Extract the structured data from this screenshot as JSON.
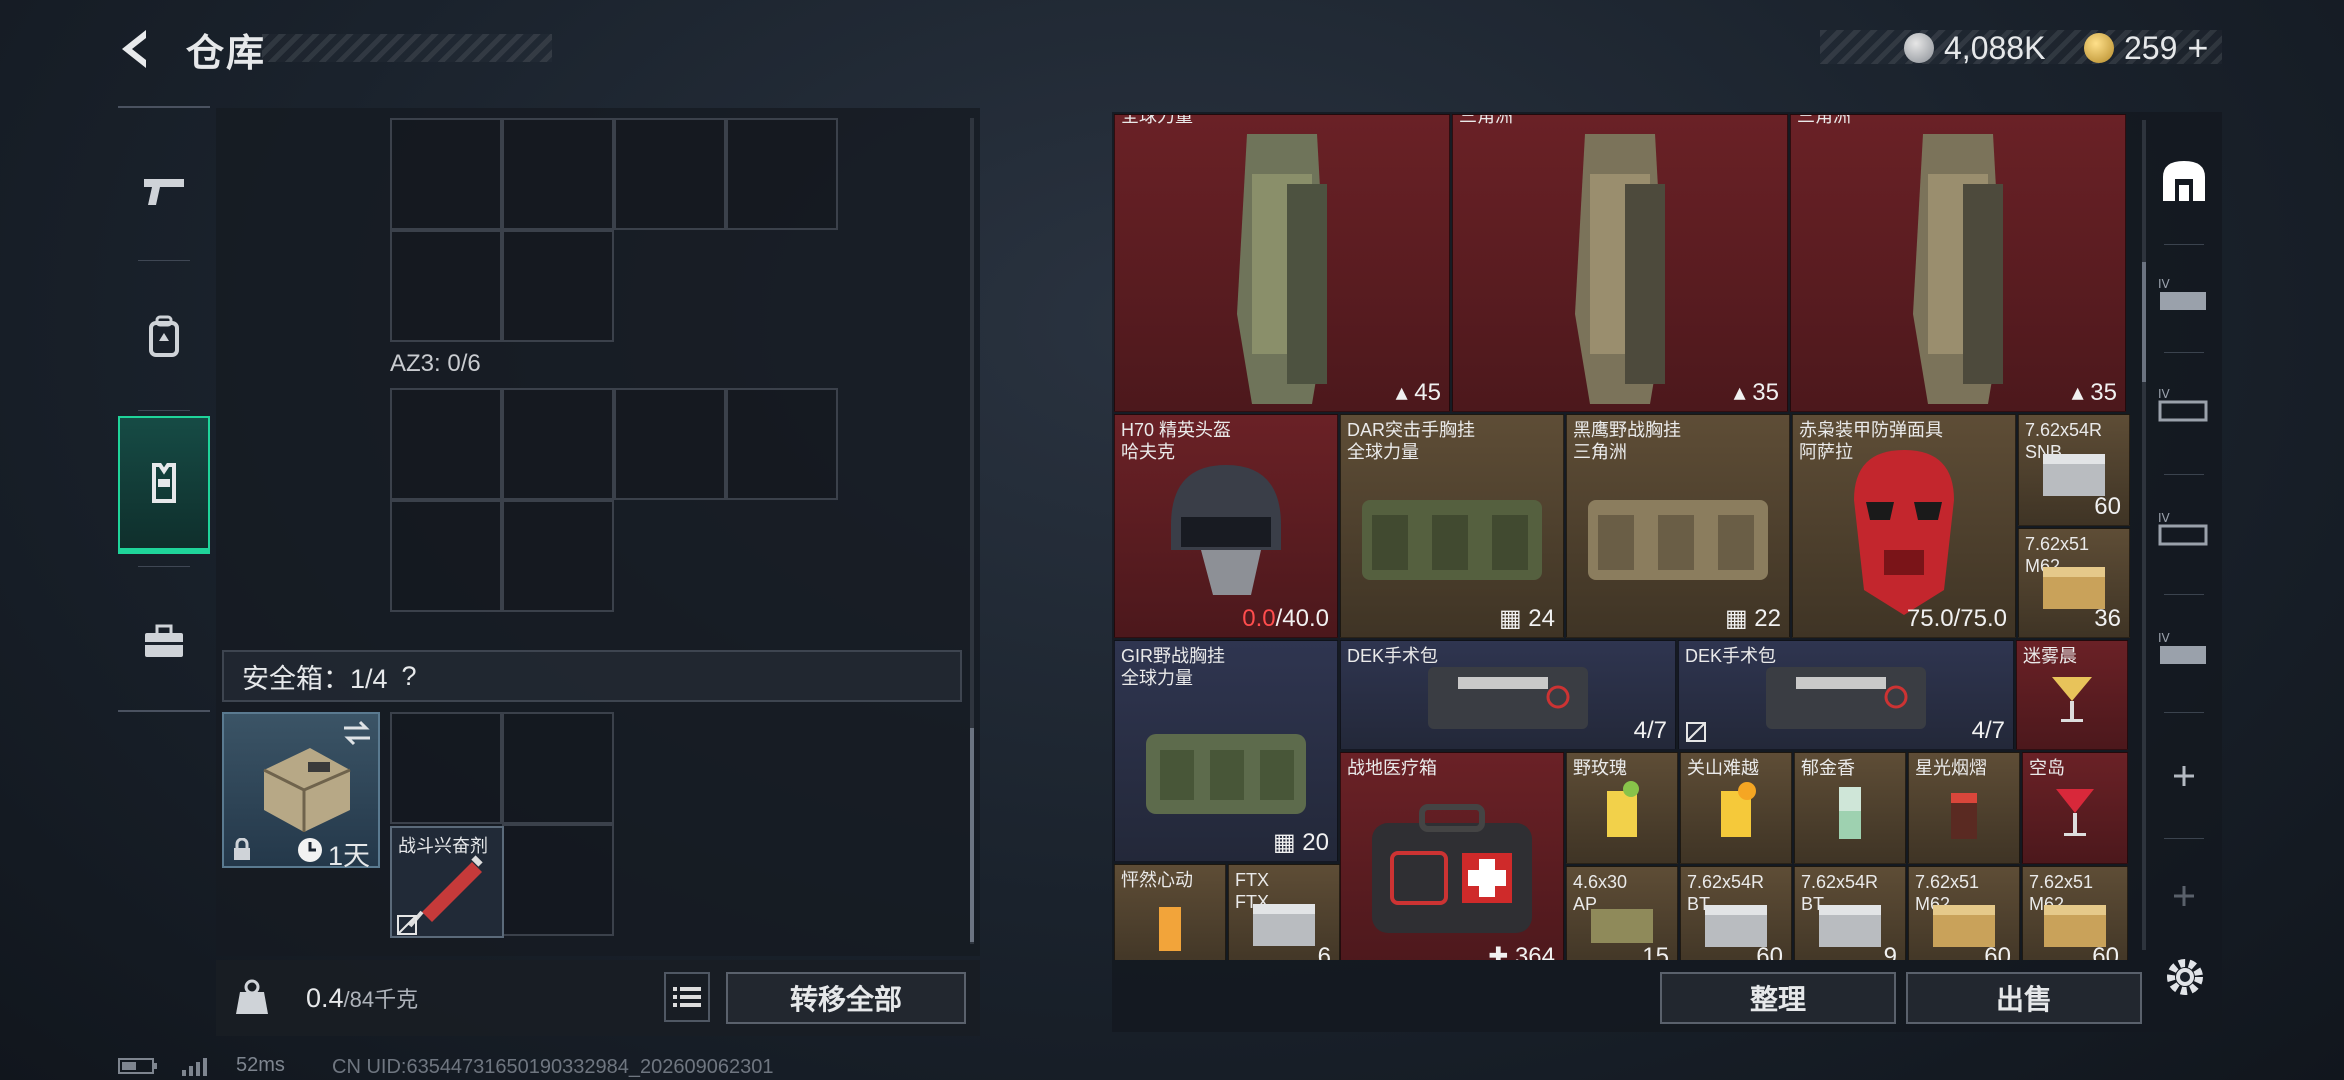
{
  "header": {
    "title": "仓库",
    "currency": [
      {
        "icon": "silver-coin-icon",
        "value": "4,088K"
      },
      {
        "icon": "gold-coin-icon",
        "value": "259"
      }
    ],
    "add_symbol": "+"
  },
  "left_nav": [
    {
      "icon": "pistol-icon"
    },
    {
      "icon": "backpack-icon"
    },
    {
      "icon": "chest-rig-icon",
      "active": true
    },
    {
      "icon": "toolbox-icon"
    }
  ],
  "container": {
    "az3_label": "AZ3: 0/6",
    "safe_box_label": "安全箱：1/4",
    "help_symbol": "?",
    "safe_case_timer": "1天",
    "stim_item_name": "战斗兴奋剂"
  },
  "weight": {
    "current": "0.4",
    "max": "/84千克"
  },
  "buttons": {
    "transfer_all": "转移全部",
    "sort": "整理",
    "sell": "出售"
  },
  "inventory": {
    "top_row": [
      {
        "name": "全球力量",
        "qty": "45"
      },
      {
        "name": "三角洲",
        "qty": "35"
      },
      {
        "name": "三角洲",
        "qty": "35"
      }
    ],
    "row2": [
      {
        "name": "H70 精英头盔\n哈夫克",
        "qty_a": "0.0",
        "qty_b": "/40.0"
      },
      {
        "name": "DAR突击手胸挂\n全球力量",
        "qty": "24"
      },
      {
        "name": "黑鹰野战胸挂\n三角洲",
        "qty": "22"
      },
      {
        "name": "赤枭装甲防弹面具\n阿萨拉",
        "qty": "75.0/75.0"
      },
      {
        "name": "7.62x54R\nSNB",
        "qty": "60"
      }
    ],
    "row3_ammo": {
      "name": "7.62x51\nM62",
      "qty": "36"
    },
    "row4": [
      {
        "name": "GIR野战胸挂\n全球力量",
        "qty": "20"
      },
      {
        "name": "DEK手术包",
        "qty": "4/7"
      },
      {
        "name": "DEK手术包",
        "qty": "4/7"
      },
      {
        "name": "迷雾晨",
        "qty": ""
      }
    ],
    "row5": [
      {
        "name": "战地医疗箱",
        "qty": "364"
      },
      {
        "name": "野玫瑰",
        "qty": ""
      },
      {
        "name": "关山难越",
        "qty": ""
      },
      {
        "name": "郁金香",
        "qty": ""
      },
      {
        "name": "星光烟熠",
        "qty": ""
      },
      {
        "name": "空岛",
        "qty": ""
      }
    ],
    "row6": [
      {
        "name": "怦然心动",
        "qty": ""
      },
      {
        "name": "FTX\nFTX",
        "qty": "6"
      },
      {
        "name": "4.6x30\nAP",
        "qty": "15"
      },
      {
        "name": "7.62x54R\nBT",
        "qty": "60"
      },
      {
        "name": "7.62x54R\nBT",
        "qty": "9"
      },
      {
        "name": "7.62x51\nM62",
        "qty": "60"
      },
      {
        "name": "7.62x51\nM62",
        "qty": "60"
      }
    ]
  },
  "status": {
    "ping": "52ms",
    "uid": "CN UID:635447316501903329​84_202609062301"
  },
  "colors": {
    "accent": "#1fd49a",
    "red_rarity": "#6a2126",
    "gold_rarity": "#5e4d36",
    "purple_rarity": "#2f3550"
  }
}
